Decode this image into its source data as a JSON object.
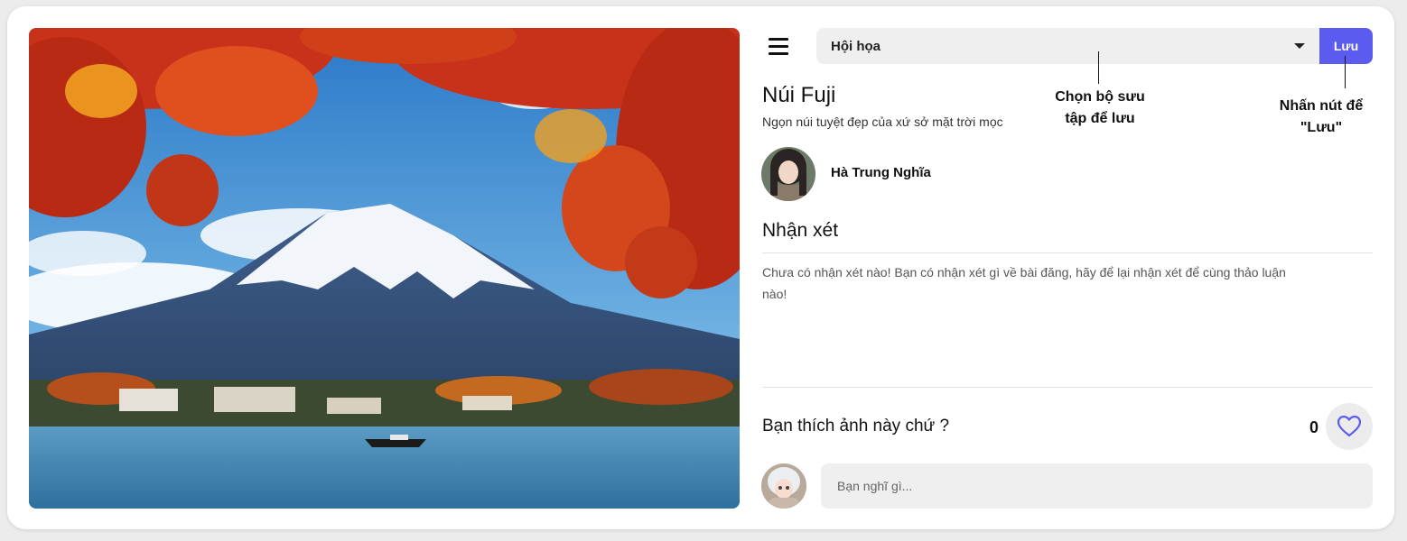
{
  "post": {
    "title": "Núi Fuji",
    "description": "Ngọn núi tuyệt đẹp của xứ sở mặt trời mọc",
    "author": "Hà Trung Nghĩa"
  },
  "toolbar": {
    "menu_icon": "hamburger-menu-icon",
    "collection_selected": "Hội họa",
    "save_label": "Lưu"
  },
  "annotations": {
    "select_hint_line1": "Chọn bộ sưu",
    "select_hint_line2": "tập để lưu",
    "save_hint_line1": "Nhấn nút để",
    "save_hint_line2": "\"Lưu\""
  },
  "comments": {
    "title": "Nhận xét",
    "empty_line1": "Chưa có nhận xét nào! Bạn có nhận xét gì về bài đăng, hãy để lại nhận xét để cùng thảo luận",
    "empty_line2": "nào!"
  },
  "reactions": {
    "question": "Bạn thích ảnh này chứ ?",
    "like_count": "0",
    "like_icon": "heart-icon"
  },
  "comment_box": {
    "placeholder": "Bạn nghĩ gì..."
  },
  "colors": {
    "accent": "#5b5bf0",
    "field_bg": "#efefef"
  }
}
